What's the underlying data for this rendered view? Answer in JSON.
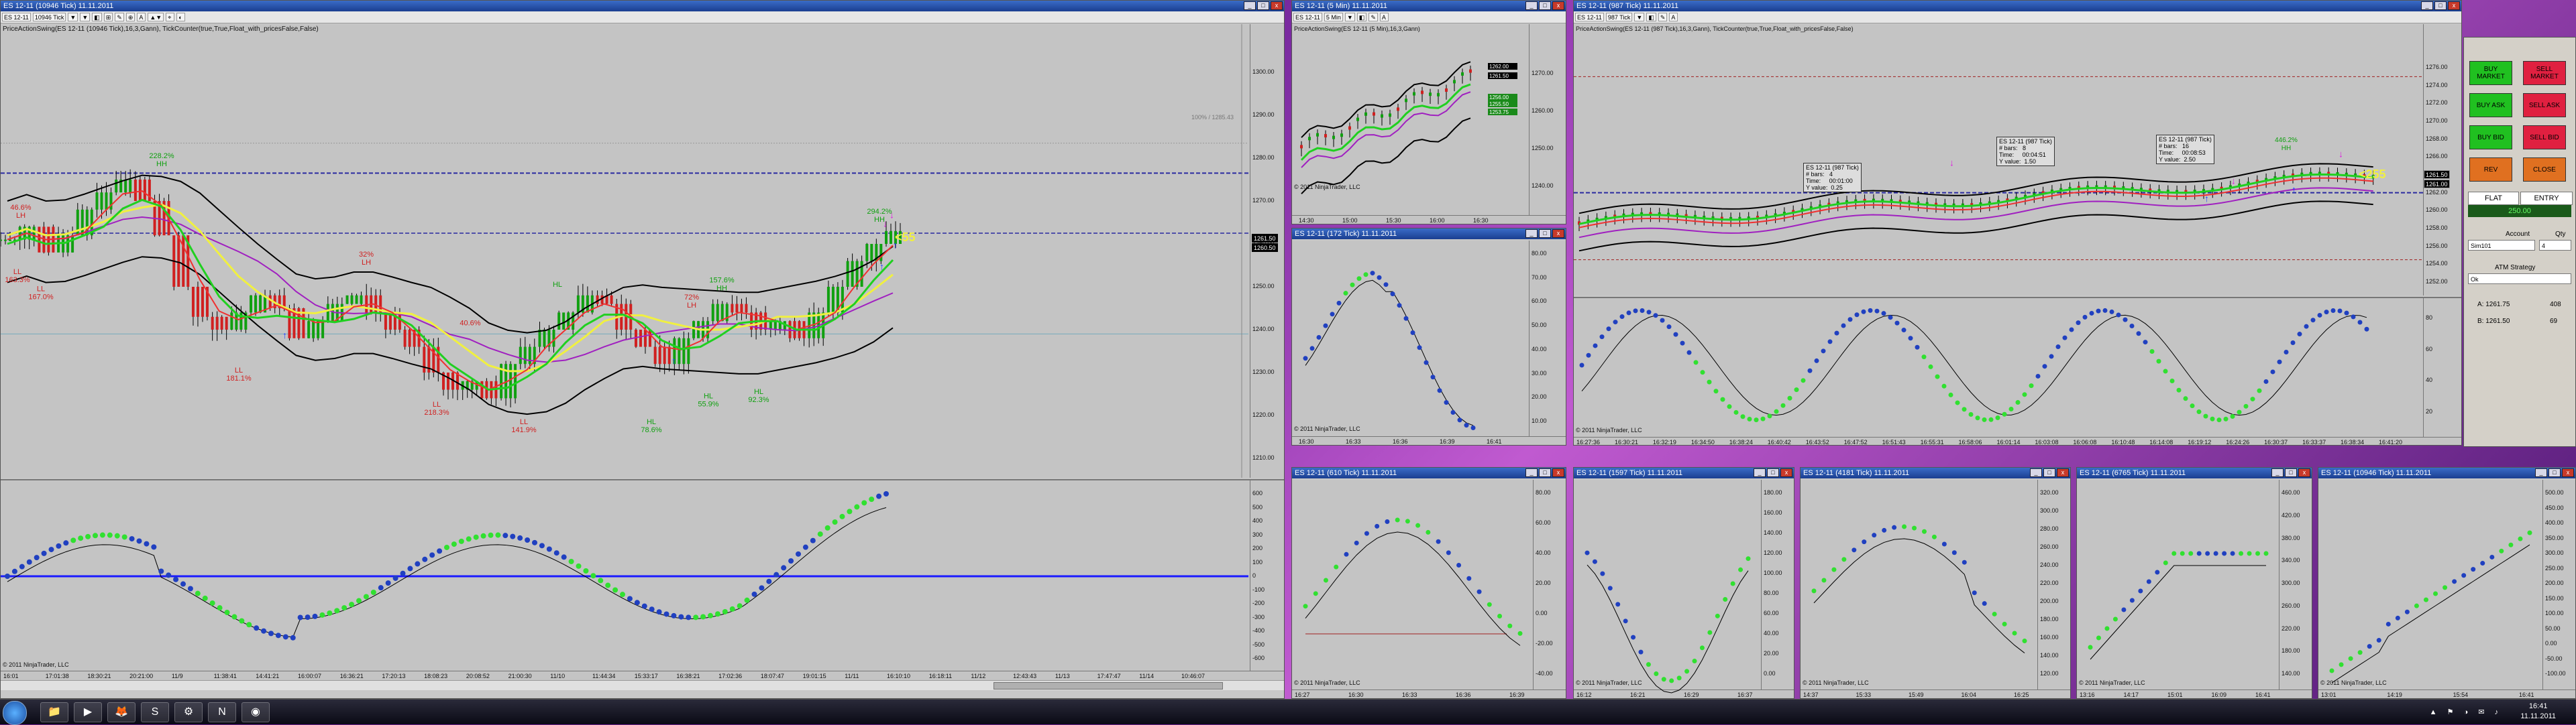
{
  "colors": {
    "price_up": "#10a010",
    "price_down": "#d02020",
    "neutral": "#000000",
    "band_black": "#000000",
    "ema_purple": "#a020c0",
    "ema_yellow": "#f0f040",
    "ema_green": "#20d020",
    "dots_blue": "#2040c0",
    "dots_green": "#30e030",
    "hline_blue": "#2a2aa0",
    "hline_red": "#a02020",
    "panel_bg": "#c4c4c4",
    "btn_green": "#20c020",
    "btn_red": "#e02040",
    "btn_orange": "#e07020"
  },
  "main": {
    "title": "ES 12-11 (10946 Tick)  11.11.2011",
    "toolbar": [
      "ES 12-11",
      "10946 Tick",
      "▼",
      "▼",
      "◧",
      "⊞",
      "✎",
      "⊕",
      "A",
      "▲▼",
      "⌖",
      "◐"
    ],
    "indicator": "PriceActionSwing(ES 12-11 (10946 Tick),16,3,Gann), TickCounter(true,True,Float_with_pricesFalse,False)",
    "price_badge": "1261.50",
    "price_badge2": "1260.50",
    "ref_line_label": "100% / 1285.43",
    "yaxis": [
      "1300.00",
      "1290.00",
      "1280.00",
      "1270.00",
      "1260.00",
      "1250.00",
      "1240.00",
      "1230.00",
      "1220.00",
      "1210.00"
    ],
    "swing_labels": [
      {
        "text": "46.6%\nLH",
        "color": "#d02020"
      },
      {
        "text": "LL\n163.3%",
        "color": "#d02020"
      },
      {
        "text": "LL\n167.0%",
        "color": "#d02020"
      },
      {
        "text": "228.2%\nHH",
        "color": "#10a010"
      },
      {
        "text": "LL\n181.1%",
        "color": "#d02020"
      },
      {
        "text": "32%\nLH",
        "color": "#d02020"
      },
      {
        "text": "40.6%",
        "color": "#d02020"
      },
      {
        "text": "LL\n218.3%",
        "color": "#d02020"
      },
      {
        "text": "LL\n141.9%",
        "color": "#d02020"
      },
      {
        "text": "HL",
        "color": "#10a010"
      },
      {
        "text": "72%\nLH",
        "color": "#d02020"
      },
      {
        "text": "157.6%\nHH",
        "color": "#10a010"
      },
      {
        "text": "HL\n78.6%",
        "color": "#10a010"
      },
      {
        "text": "HL\n55.9%",
        "color": "#10a010"
      },
      {
        "text": "HL\n92.3%",
        "color": "#10a010"
      },
      {
        "text": "294.2%\nHH",
        "color": "#10a010"
      }
    ],
    "countdown": "<55",
    "osc_yaxis": [
      "600",
      "500",
      "400",
      "300",
      "200",
      "100",
      "0",
      "-100",
      "-200",
      "-300",
      "-400",
      "-500",
      "-600"
    ],
    "copyright": "© 2011 NinjaTrader, LLC",
    "xaxis": [
      "16:01",
      "17:01:38",
      "18:30:21",
      "20:21:00",
      "11/9",
      "11:38:41",
      "14:41:21",
      "16:00:07",
      "16:36:21",
      "17:20:13",
      "18:08:23",
      "20:08:52",
      "21:00:30",
      "11/10",
      "11:44:34",
      "15:33:17",
      "16:38:21",
      "17:02:36",
      "18:07:47",
      "19:01:15",
      "11/11",
      "16:10:10",
      "16:18:11",
      "11/12",
      "12:43:43",
      "11/13",
      "17:47:47",
      "11/14",
      "10:46:07"
    ]
  },
  "win_5min": {
    "title": "ES 12-11 (5 Min)  11.11.2011",
    "toolbar": [
      "ES 12-11",
      "5 Min",
      "▼",
      "◧",
      "✎",
      "A"
    ],
    "indicator": "PriceActionSwing(ES 12-11 (5 Min),16,3,Gann)",
    "yaxis": [
      "1270.00",
      "1260.00",
      "1250.00",
      "1240.00"
    ],
    "badges": [
      "1262.00",
      "1261.50",
      "1256.00",
      "1255.50",
      "1253.75"
    ],
    "xaxis": [
      "14:30",
      "15:00",
      "15:30",
      "16:00",
      "16:30"
    ],
    "copyright": "© 2011 NinjaTrader, LLC"
  },
  "win_tick_a": {
    "title": "ES 12-11 (172 Tick)  11.11.2011",
    "yaxis": [
      "80.00",
      "70.00",
      "60.00",
      "50.00",
      "40.00",
      "30.00",
      "20.00",
      "10.00"
    ],
    "xaxis": [
      "16:30",
      "16:33",
      "16:36",
      "16:39",
      "16:41"
    ],
    "copyright": "© 2011 NinjaTrader, LLC"
  },
  "win_987": {
    "title": "ES 12-11 (987 Tick)  11.11.2011",
    "toolbar": [
      "ES 12-11",
      "987 Tick",
      "▼",
      "◧",
      "✎",
      "A"
    ],
    "indicator": "PriceActionSwing(ES 12-11 (987 Tick),16,3,Gann), TickCounter(true,True,Float_with_pricesFalse,False)",
    "yaxis": [
      "1276.00",
      "1274.00",
      "1272.00",
      "1270.00",
      "1268.00",
      "1266.00",
      "1264.00",
      "1262.00",
      "1260.00",
      "1258.00",
      "1256.00",
      "1254.00",
      "1252.00"
    ],
    "badges": [
      "1261.50",
      "1261.00"
    ],
    "countdown": "<255",
    "hh_label": "446.2%\nHH",
    "tooltips": [
      "ES 12-11 (987 Tick)\n# bars:   4\nTime:     00:01:00\nY value:  0.25",
      "ES 12-11 (987 Tick)\n# bars:   8\nTime:     00:04:51\nY value:  1.50",
      "ES 12-11 (987 Tick)\n# bars:   16\nTime:     00:08:53\nY value:  2.50"
    ],
    "osc_yaxis": [
      "80",
      "60",
      "40",
      "20"
    ],
    "xaxis": [
      "16:27:36",
      "16:30:21",
      "16:32:19",
      "16:34:50",
      "16:38:24",
      "16:40:42",
      "16:43:52",
      "16:47:52",
      "16:51:43",
      "16:55:31",
      "16:58:06",
      "16:01:14",
      "16:03:08",
      "16:06:08",
      "16:10:48",
      "16:14:08",
      "16:19:12",
      "16:24:26",
      "16:30:37",
      "16:33:37",
      "16:38:34",
      "16:41:20"
    ],
    "copyright": "© 2011 NinjaTrader, LLC"
  },
  "right_panel": {
    "buttons": [
      {
        "label": "BUY\nMARKET",
        "color": "#20c020"
      },
      {
        "label": "SELL\nMARKET",
        "color": "#e02040"
      },
      {
        "label": "BUY ASK",
        "color": "#20c020"
      },
      {
        "label": "SELL ASK",
        "color": "#e02040"
      },
      {
        "label": "BUY BID",
        "color": "#20c020"
      },
      {
        "label": "SELL BID",
        "color": "#e02040"
      },
      {
        "label": "REV",
        "color": "#e07020"
      },
      {
        "label": "CLOSE",
        "color": "#e07020"
      }
    ],
    "position": "FLAT",
    "entry_label": "ENTRY",
    "pnl": "250.00",
    "account_label": "Account",
    "qty_label": "Qty",
    "account_value": "Sim101",
    "qty_value": "4",
    "atm_label": "ATM Strategy",
    "atm_value": "Ok",
    "ask_label": "A: 1261.75",
    "ask_size": "408",
    "bid_label": "B: 1261.50",
    "bid_size": "69"
  },
  "bottom_windows": [
    {
      "title": "ES 12-11 (610 Tick)  11.11.2011",
      "yaxis": [
        "80.00",
        "60.00",
        "40.00",
        "20.00",
        "0.00",
        "-20.00",
        "-40.00"
      ],
      "xaxis": [
        "16:27",
        "16:30",
        "16:33",
        "16:36",
        "16:39"
      ]
    },
    {
      "title": "ES 12-11 (1597 Tick)  11.11.2011",
      "yaxis": [
        "180.00",
        "160.00",
        "140.00",
        "120.00",
        "100.00",
        "80.00",
        "60.00",
        "40.00",
        "20.00",
        "0.00"
      ],
      "xaxis": [
        "16:12",
        "16:21",
        "16:29",
        "16:37"
      ]
    },
    {
      "title": "ES 12-11 (4181 Tick)  11.11.2011",
      "yaxis": [
        "320.00",
        "300.00",
        "280.00",
        "260.00",
        "240.00",
        "220.00",
        "200.00",
        "180.00",
        "160.00",
        "140.00",
        "120.00"
      ],
      "xaxis": [
        "14:37",
        "15:33",
        "15:49",
        "16:04",
        "16:25"
      ]
    },
    {
      "title": "ES 12-11 (6765 Tick)  11.11.2011",
      "yaxis": [
        "460.00",
        "420.00",
        "380.00",
        "340.00",
        "300.00",
        "260.00",
        "220.00",
        "180.00",
        "140.00"
      ],
      "xaxis": [
        "13:16",
        "14:17",
        "15:01",
        "16:09",
        "16:41"
      ]
    },
    {
      "title": "ES 12-11 (10946 Tick)  11.11.2011",
      "yaxis": [
        "500.00",
        "450.00",
        "400.00",
        "350.00",
        "300.00",
        "250.00",
        "200.00",
        "150.00",
        "100.00",
        "50.00",
        "0.00",
        "-50.00",
        "-100.00"
      ],
      "xaxis": [
        "13:01",
        "14:19",
        "15:54",
        "16:41"
      ]
    }
  ],
  "taskbar": {
    "apps": [
      "📁",
      "▶",
      "🦊",
      "S",
      "⚙",
      "N",
      "◉"
    ],
    "tray": "▲ ⚑ ◑ ✉ ♪",
    "time": "16:41",
    "date": "11.11.2011"
  }
}
